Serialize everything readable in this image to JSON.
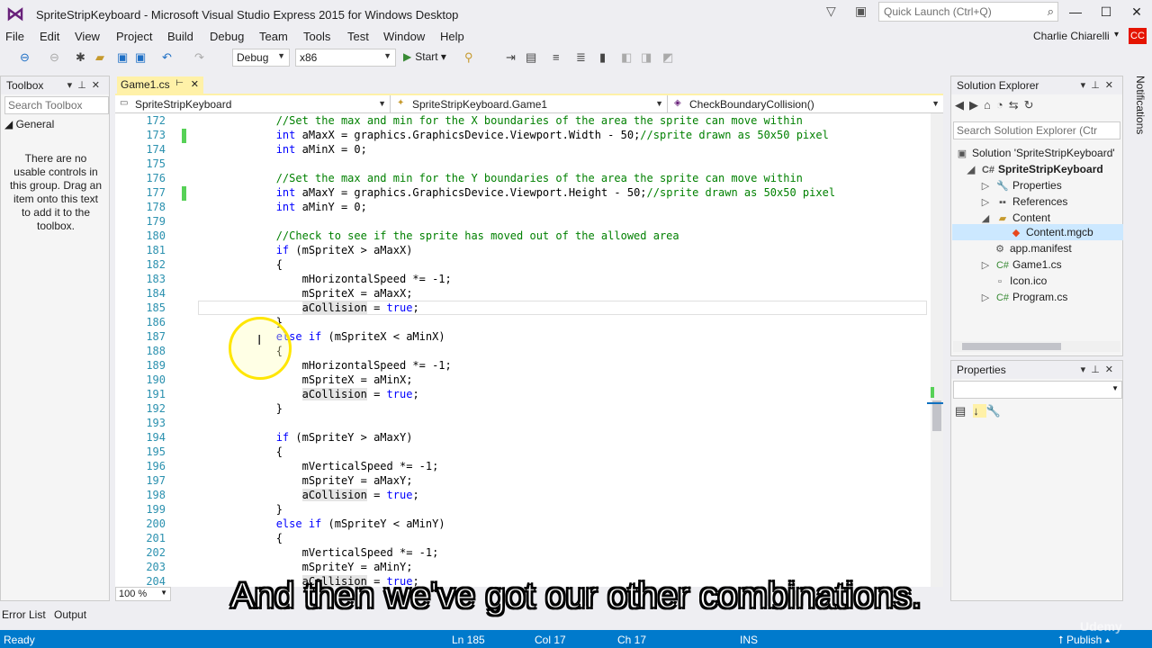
{
  "window": {
    "title": "SpriteStripKeyboard - Microsoft Visual Studio Express 2015 for Windows Desktop",
    "quick_launch_placeholder": "Quick Launch (Ctrl+Q)",
    "min": "—",
    "max": "☐",
    "close": "✕"
  },
  "menu": [
    "File",
    "Edit",
    "View",
    "Project",
    "Build",
    "Debug",
    "Team",
    "Tools",
    "Test",
    "Window",
    "Help"
  ],
  "user": {
    "name": "Charlie Chiarelli",
    "initials": "CC"
  },
  "toolbar": {
    "config": "Debug",
    "platform": "x86",
    "start_label": "Start"
  },
  "toolbox": {
    "title": "Toolbox",
    "search_placeholder": "Search Toolbox",
    "group": "General",
    "empty_message": "There are no usable controls in this group. Drag an item onto this text to add it to the toolbox."
  },
  "document": {
    "tab": "Game1.cs",
    "nav_project": "SpriteStripKeyboard",
    "nav_class": "SpriteStripKeyboard.Game1",
    "nav_member": "CheckBoundaryCollision()",
    "zoom": "100 %"
  },
  "code": {
    "line_numbers": [
      "172",
      "173",
      "174",
      "175",
      "176",
      "177",
      "178",
      "179",
      "180",
      "181",
      "182",
      "183",
      "184",
      "185",
      "186",
      "187",
      "188",
      "189",
      "190",
      "191",
      "192",
      "193",
      "194",
      "195",
      "196",
      "197",
      "198",
      "199",
      "200",
      "201",
      "202",
      "203",
      "204"
    ]
  },
  "solution_explorer": {
    "title": "Solution Explorer",
    "search_placeholder": "Search Solution Explorer (Ctr",
    "items": [
      "Solution 'SpriteStripKeyboard'",
      "SpriteStripKeyboard",
      "Properties",
      "References",
      "Content",
      "Content.mgcb",
      "app.manifest",
      "Game1.cs",
      "Icon.ico",
      "Program.cs"
    ]
  },
  "properties": {
    "title": "Properties"
  },
  "notifications": "Notifications",
  "bottom_tabs": [
    "Error List",
    "Output"
  ],
  "status": {
    "ready": "Ready",
    "ln": "Ln 185",
    "col": "Col 17",
    "ch": "Ch 17",
    "ins": "INS",
    "publish": "Publish"
  },
  "subtitle": "And then we've got our other combinations.",
  "watermark": "Udemy"
}
